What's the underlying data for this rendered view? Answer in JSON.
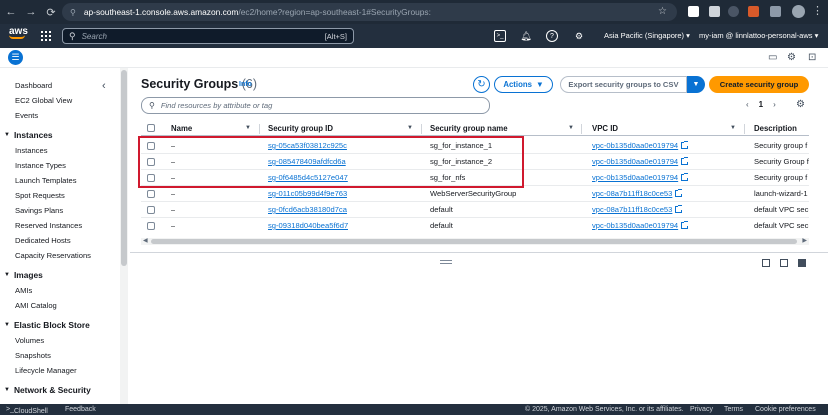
{
  "browser": {
    "url_host": "ap-southeast-1.console.aws.amazon.com",
    "url_path": "/ec2/home?region=ap-southeast-1#SecurityGroups:"
  },
  "topnav": {
    "logo": "aws",
    "search_placeholder": "Search",
    "search_shortcut": "[Alt+S]",
    "region": "Asia Pacific (Singapore)",
    "account": "my-iam @ linnlattoo-personal-aws"
  },
  "sidebar": {
    "items": [
      {
        "label": "Dashboard"
      },
      {
        "label": "EC2 Global View"
      },
      {
        "label": "Events"
      }
    ],
    "sections": [
      {
        "title": "Instances",
        "items": [
          "Instances",
          "Instance Types",
          "Launch Templates",
          "Spot Requests",
          "Savings Plans",
          "Reserved Instances",
          "Dedicated Hosts",
          "Capacity Reservations"
        ]
      },
      {
        "title": "Images",
        "items": [
          "AMIs",
          "AMI Catalog"
        ]
      },
      {
        "title": "Elastic Block Store",
        "items": [
          "Volumes",
          "Snapshots",
          "Lifecycle Manager"
        ]
      },
      {
        "title": "Network & Security",
        "items": []
      }
    ]
  },
  "main": {
    "title": "Security Groups",
    "count": "(6)",
    "info": "Info",
    "actions_label": "Actions",
    "export_label": "Export security groups to CSV",
    "create_label": "Create security group",
    "filter_placeholder": "Find resources by attribute or tag",
    "page_number": "1"
  },
  "table": {
    "columns": [
      "Name",
      "Security group ID",
      "Security group name",
      "VPC ID",
      "Description"
    ],
    "rows": [
      {
        "name": "–",
        "sg_id": "sg-05ca53f03812c925c",
        "sg_name": "sg_for_instance_1",
        "vpc": "vpc-0b135d0aa0e019794",
        "desc": "Security group f"
      },
      {
        "name": "–",
        "sg_id": "sg-085478409afdfcd6a",
        "sg_name": "sg_for_instance_2",
        "vpc": "vpc-0b135d0aa0e019794",
        "desc": "Security Group f"
      },
      {
        "name": "–",
        "sg_id": "sg-0f6485d4c5127e047",
        "sg_name": "sg_for_nfs",
        "vpc": "vpc-0b135d0aa0e019794",
        "desc": "Security group f"
      },
      {
        "name": "–",
        "sg_id": "sg-011c05b99d4f9e763",
        "sg_name": "WebServerSecurityGroup",
        "vpc": "vpc-08a7b11ff18c0ce53",
        "desc": "launch-wizard-1"
      },
      {
        "name": "–",
        "sg_id": "sg-0fcd6acb38180d7ca",
        "sg_name": "default",
        "vpc": "vpc-08a7b11ff18c0ce53",
        "desc": "default VPC secu"
      },
      {
        "name": "–",
        "sg_id": "sg-09318d040bea5f6d7",
        "sg_name": "default",
        "vpc": "vpc-0b135d0aa0e019794",
        "desc": "default VPC secu"
      }
    ]
  },
  "footer": {
    "cloudshell": "CloudShell",
    "feedback": "Feedback",
    "copyright": "© 2025, Amazon Web Services, Inc. or its affiliates.",
    "privacy": "Privacy",
    "terms": "Terms",
    "cookies": "Cookie preferences"
  },
  "colors": {
    "aws_nav": "#232f3e",
    "link_blue": "#0972d3",
    "primary_orange": "#ff9900",
    "highlight_red": "#d0192e"
  }
}
